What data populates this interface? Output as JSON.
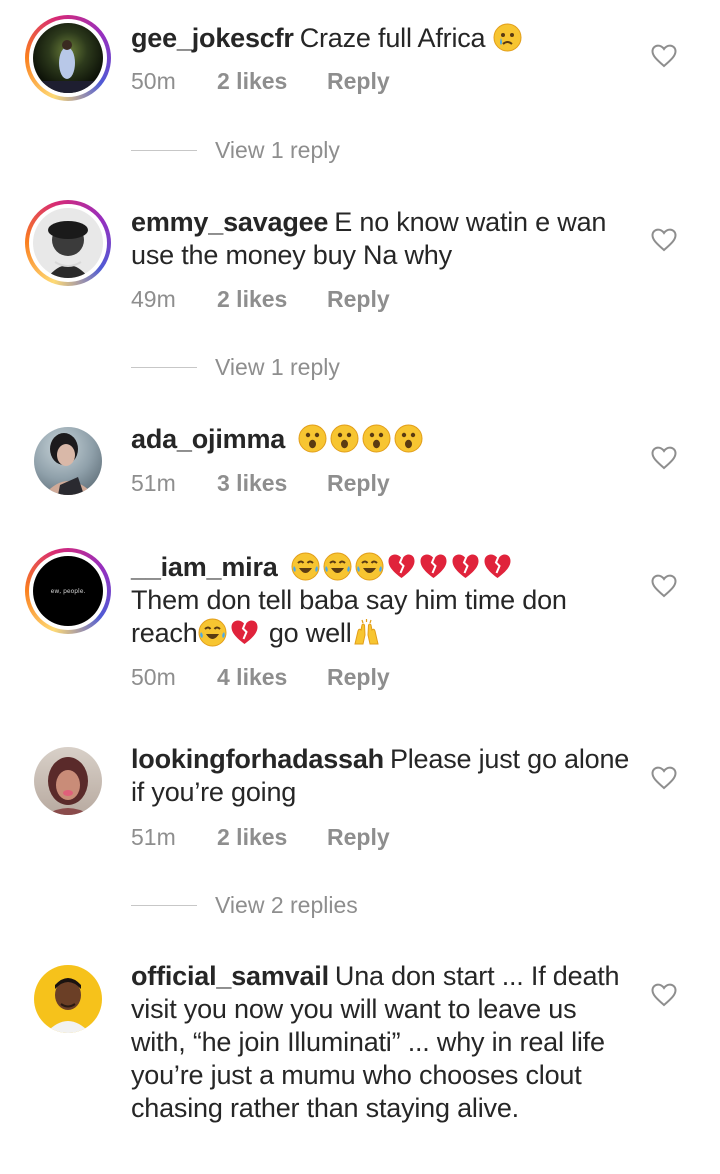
{
  "comments": [
    {
      "username": "gee_jokescfr",
      "text": "Craze full Africa",
      "emoji": "😢",
      "time": "50m",
      "likes": "2 likes",
      "reply": "Reply",
      "view_replies": "View 1 reply"
    },
    {
      "username": "emmy_savagee",
      "text": "E no know watin e wan use the money buy Na why",
      "time": "49m",
      "likes": "2 likes",
      "reply": "Reply",
      "view_replies": "View 1 reply"
    },
    {
      "username": "ada_ojimma",
      "text": "",
      "emoji": "😮😮😮😮",
      "time": "51m",
      "likes": "3 likes",
      "reply": "Reply"
    },
    {
      "username": "__iam_mira",
      "emoji": "😂😂😂💔💔💔💔",
      "text": "Them don tell baba say him time don reach",
      "emoji2": "😂💔",
      "text2": "go well",
      "emoji3": "🙌",
      "time": "50m",
      "likes": "4 likes",
      "reply": "Reply"
    },
    {
      "username": "lookingforhadassah",
      "text": "Please just go alone if you’re going",
      "time": "51m",
      "likes": "2 likes",
      "reply": "Reply",
      "view_replies": "View 2 replies"
    },
    {
      "username": "official_samvail",
      "text": "Una don start ... If death visit you now you will want to leave us with, “he join Illuminati” ... why in real life you’re just a mumu who chooses clout chasing rather than staying alive."
    }
  ],
  "avatars": {
    "mira_caption": "ew, people."
  },
  "icons": {
    "like": "heart-outline-icon"
  },
  "colors": {
    "muted": "#8e8e8e",
    "text": "#262626"
  }
}
